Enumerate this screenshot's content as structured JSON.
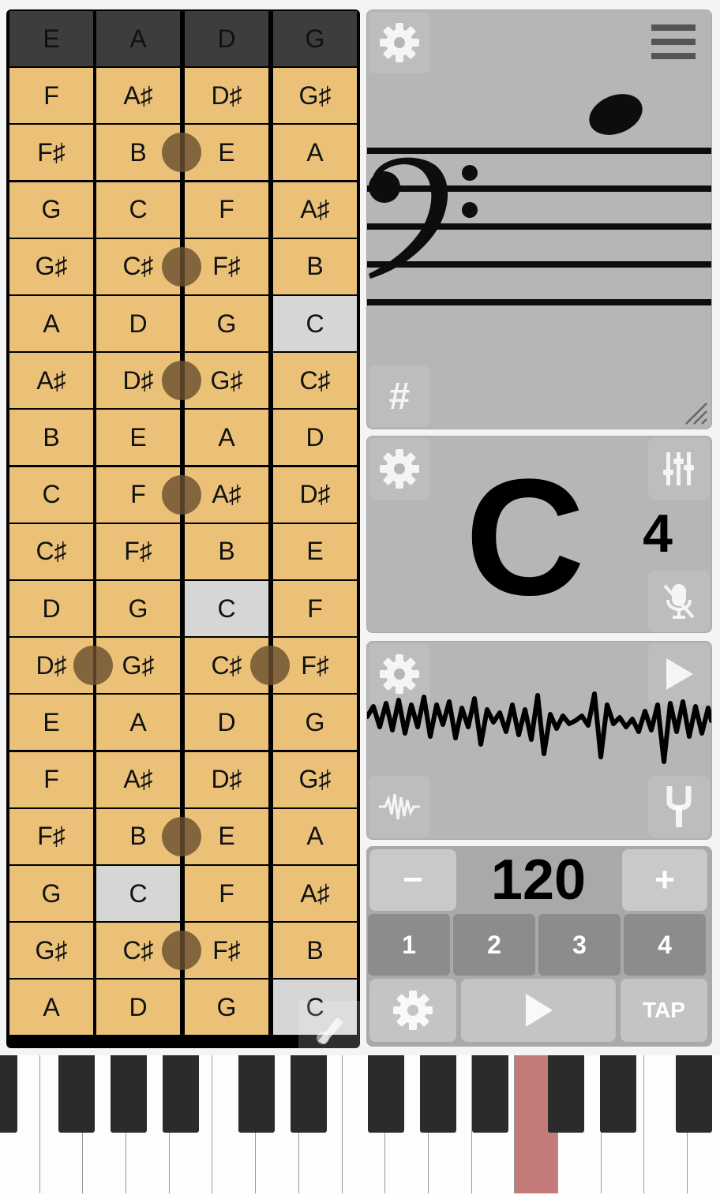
{
  "fretboard": {
    "strings": [
      "E",
      "A",
      "D",
      "G"
    ],
    "rows": [
      [
        "F",
        "A♯",
        "D♯",
        "G♯"
      ],
      [
        "F♯",
        "B",
        "E",
        "A"
      ],
      [
        "G",
        "C",
        "F",
        "A♯"
      ],
      [
        "G♯",
        "C♯",
        "F♯",
        "B"
      ],
      [
        "A",
        "D",
        "G",
        "C"
      ],
      [
        "A♯",
        "D♯",
        "G♯",
        "C♯"
      ],
      [
        "B",
        "E",
        "A",
        "D"
      ],
      [
        "C",
        "F",
        "A♯",
        "D♯"
      ],
      [
        "C♯",
        "F♯",
        "B",
        "E"
      ],
      [
        "D",
        "G",
        "C",
        "F"
      ],
      [
        "D♯",
        "G♯",
        "C♯",
        "F♯"
      ],
      [
        "E",
        "A",
        "D",
        "G"
      ],
      [
        "F",
        "A♯",
        "D♯",
        "G♯"
      ],
      [
        "F♯",
        "B",
        "E",
        "A"
      ],
      [
        "G",
        "C",
        "F",
        "A♯"
      ],
      [
        "G♯",
        "C♯",
        "F♯",
        "B"
      ],
      [
        "A",
        "D",
        "G",
        "C"
      ]
    ],
    "highlighted": [
      [
        4,
        3
      ],
      [
        9,
        2
      ],
      [
        14,
        1
      ],
      [
        16,
        3
      ]
    ],
    "edit_icon": "guitar-pencil-icon"
  },
  "staff": {
    "clef": "bass-clef",
    "accidental_label": "#",
    "settings_icon": "gear-icon",
    "menu_icon": "hamburger-menu-icon",
    "resize_icon": "resize-handle-icon"
  },
  "note_display": {
    "note": "C",
    "octave": "4",
    "settings_icon": "gear-icon",
    "mixer_icon": "sliders-icon",
    "mic_icon": "mic-muted-icon"
  },
  "waveform": {
    "settings_icon": "gear-icon",
    "play_icon": "play-icon",
    "wave_icon": "waveform-icon",
    "fork_icon": "tuning-fork-icon"
  },
  "metronome": {
    "minus": "−",
    "bpm": "120",
    "plus": "+",
    "beats": [
      "1",
      "2",
      "3",
      "4"
    ],
    "settings_icon": "gear-icon",
    "play_icon": "play-icon",
    "tap": "TAP"
  },
  "piano": {
    "active_key": "C4"
  },
  "colors": {
    "fret_cell": "#ebc178",
    "header_cell": "#3d3d3d",
    "highlight": "#d6d6d6",
    "panel": "#b6b6b6",
    "active_piano_key": "#c57a7a"
  }
}
